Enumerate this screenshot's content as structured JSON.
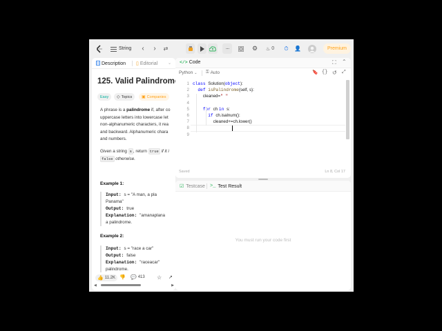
{
  "topbar": {
    "topic_label": "String",
    "coins": "0",
    "premium_label": "Premium"
  },
  "left": {
    "tab_description": "Description",
    "tab_editorial": "Editorial",
    "problem_title": "125. Valid Palindrome",
    "chip_easy": "Easy",
    "chip_topics": "Topics",
    "chip_companies": "Companies",
    "desc_lines": [
      [
        "A phrase is a ",
        "palindrome",
        " if, after co"
      ],
      [
        "uppercase letters into lowercase let"
      ],
      [
        "non-alphanumeric characters, it rea"
      ],
      [
        "and backward. Alphanumeric chara"
      ],
      [
        "and numbers."
      ]
    ],
    "given_line": [
      "Given a string ",
      "s",
      ", return ",
      "true",
      " if it i"
    ],
    "false_line": [
      "false",
      " otherwise."
    ],
    "example1_title": "Example 1:",
    "example1": [
      [
        "Input: ",
        "s = \"A man, a pla"
      ],
      [
        "",
        "Panama\""
      ],
      [
        "Output: ",
        "true"
      ],
      [
        "Explanation: ",
        "\"amanaplana"
      ],
      [
        "",
        "a palindrome."
      ]
    ],
    "example2_title": "Example 2:",
    "example2": [
      [
        "Input: ",
        "s = \"race a car\""
      ],
      [
        "Output: ",
        "false"
      ],
      [
        "Explanation: ",
        "\"raceacar\""
      ],
      [
        "",
        "palindrome."
      ]
    ],
    "likes": "11.2K",
    "comments": "413"
  },
  "code": {
    "tab_label": "Code",
    "language": "Python",
    "mode": "Auto",
    "lines": [
      {
        "n": "1",
        "indent": 0,
        "parts": [
          [
            "kw",
            "class "
          ],
          [
            "",
            "Solution("
          ],
          [
            "kw",
            "object"
          ],
          [
            "",
            "):"
          ]
        ]
      },
      {
        "n": "2",
        "indent": 1,
        "parts": [
          [
            "kw",
            "def "
          ],
          [
            "fn",
            "isPalindrome"
          ],
          [
            "",
            "(self, s):"
          ]
        ]
      },
      {
        "n": "3",
        "indent": 2,
        "parts": [
          [
            "",
            "cleaned="
          ],
          [
            "st",
            "\" \""
          ]
        ]
      },
      {
        "n": "4",
        "indent": 0,
        "parts": []
      },
      {
        "n": "5",
        "indent": 2,
        "parts": [
          [
            "kw",
            "for "
          ],
          [
            "",
            "ch "
          ],
          [
            "kw",
            "in "
          ],
          [
            "",
            "s:"
          ]
        ]
      },
      {
        "n": "6",
        "indent": 3,
        "parts": [
          [
            "kw",
            "if "
          ],
          [
            "",
            "ch.isalnum():"
          ]
        ]
      },
      {
        "n": "7",
        "indent": 4,
        "parts": [
          [
            "",
            "cleaned+=ch.lower()"
          ]
        ]
      },
      {
        "n": "8",
        "indent": 0,
        "parts": []
      },
      {
        "n": "9",
        "indent": 0,
        "parts": []
      }
    ],
    "status_saved": "Saved",
    "cursor_position": "Ln 8, Col 17"
  },
  "test": {
    "tab_testcase": "Testcase",
    "tab_result": "Test Result",
    "message": "You must run your code first"
  },
  "colors": {
    "accent_orange": "#ffa116",
    "keyword_blue": "#0000ff",
    "run_green": "#2db55d",
    "code_tab_blue": "#1a73e8"
  }
}
